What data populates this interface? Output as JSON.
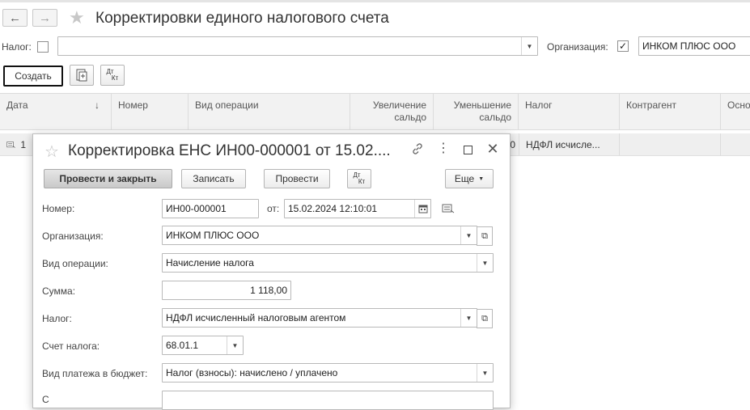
{
  "window": {
    "title": "Корректировки единого налогового счета"
  },
  "filters": {
    "tax_label": "Налог:",
    "tax_checked": false,
    "tax_value": "",
    "org_label": "Организация:",
    "org_checked": true,
    "org_check_mark": "✓",
    "org_value": "ИНКОМ ПЛЮС ООО"
  },
  "toolbar": {
    "create_label": "Создать",
    "dt_label": "Дт",
    "kt_label": "Кт"
  },
  "table": {
    "columns": {
      "date": "Дата",
      "sort_arrow": "↓",
      "number": "Номер",
      "operation": "Вид операции",
      "increase_1": "Увеличение",
      "increase_2": "сальдо",
      "decrease_1": "Уменьшение",
      "decrease_2": "сальдо",
      "tax": "Налог",
      "counterparty": "Контрагент",
      "basis": "Осно"
    },
    "row": {
      "date_fragment": "1",
      "decrease_fragment": "0",
      "tax": "НДФЛ исчисле..."
    }
  },
  "dialog": {
    "title": "Корректировка ЕНС ИН00-000001 от 15.02....",
    "buttons": {
      "post_close": "Провести и закрыть",
      "save": "Записать",
      "post": "Провести",
      "more": "Еще"
    },
    "fields": {
      "number_label": "Номер:",
      "number_value": "ИН00-000001",
      "from_label": "от:",
      "date_value": "15.02.2024 12:10:01",
      "org_label": "Организация:",
      "org_value": "ИНКОМ ПЛЮС ООО",
      "operation_label": "Вид операции:",
      "operation_value": "Начисление налога",
      "sum_label": "Сумма:",
      "sum_value": "1 118,00",
      "tax_label": "Налог:",
      "tax_value": "НДФЛ исчисленный налоговым агентом",
      "account_label": "Счет налога:",
      "account_value": "68.01.1",
      "payment_label": "Вид платежа в бюджет:",
      "payment_value": "Налог (взносы): начислено / уплачено",
      "next_label_fragment": "С"
    }
  }
}
